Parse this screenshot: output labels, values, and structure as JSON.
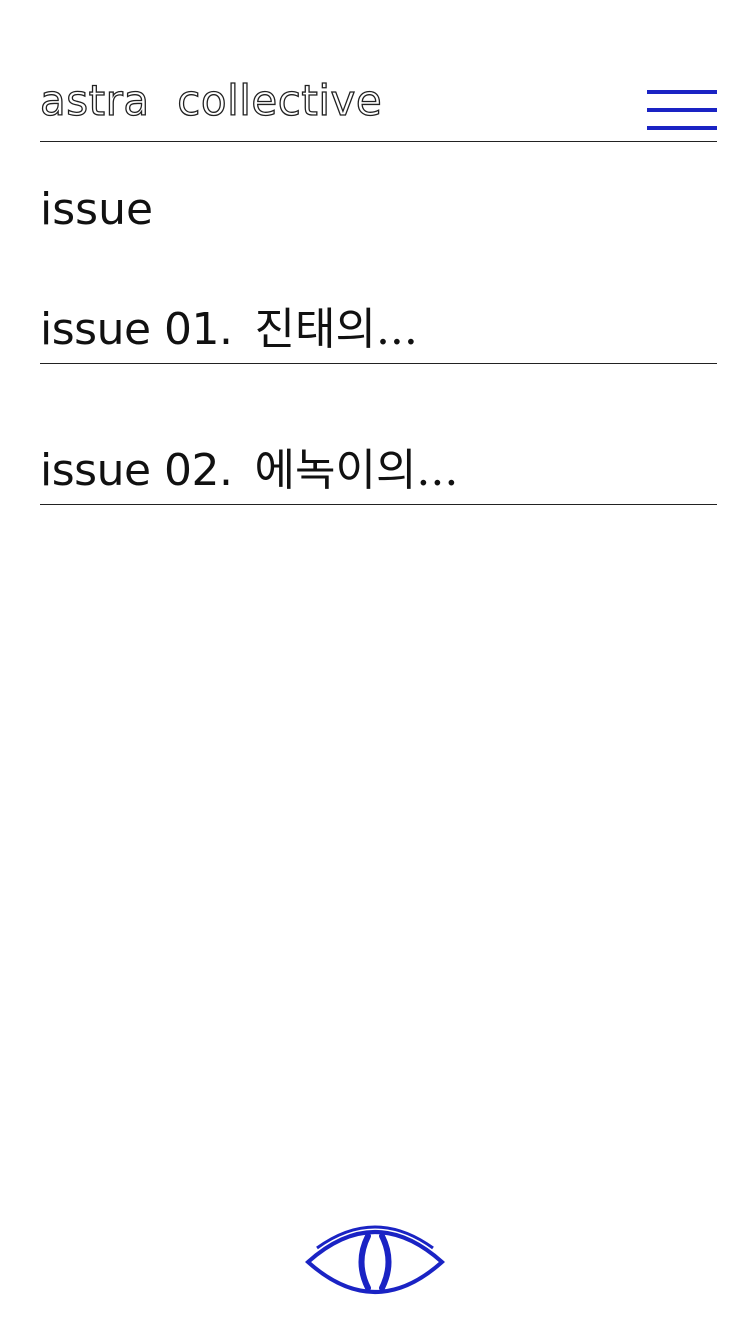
{
  "header": {
    "logo_text": "astra  collective",
    "menu_icon": "hamburger-menu-icon"
  },
  "page": {
    "title": "issue"
  },
  "issues": [
    {
      "number": "issue 01.",
      "title": "진태의..."
    },
    {
      "number": "issue 02.",
      "title": "에녹이의..."
    }
  ],
  "footer": {
    "logo_icon": "eye-icon"
  },
  "colors": {
    "accent": "#1a23c4",
    "text": "#111111",
    "rule": "#222222",
    "background": "#ffffff"
  }
}
